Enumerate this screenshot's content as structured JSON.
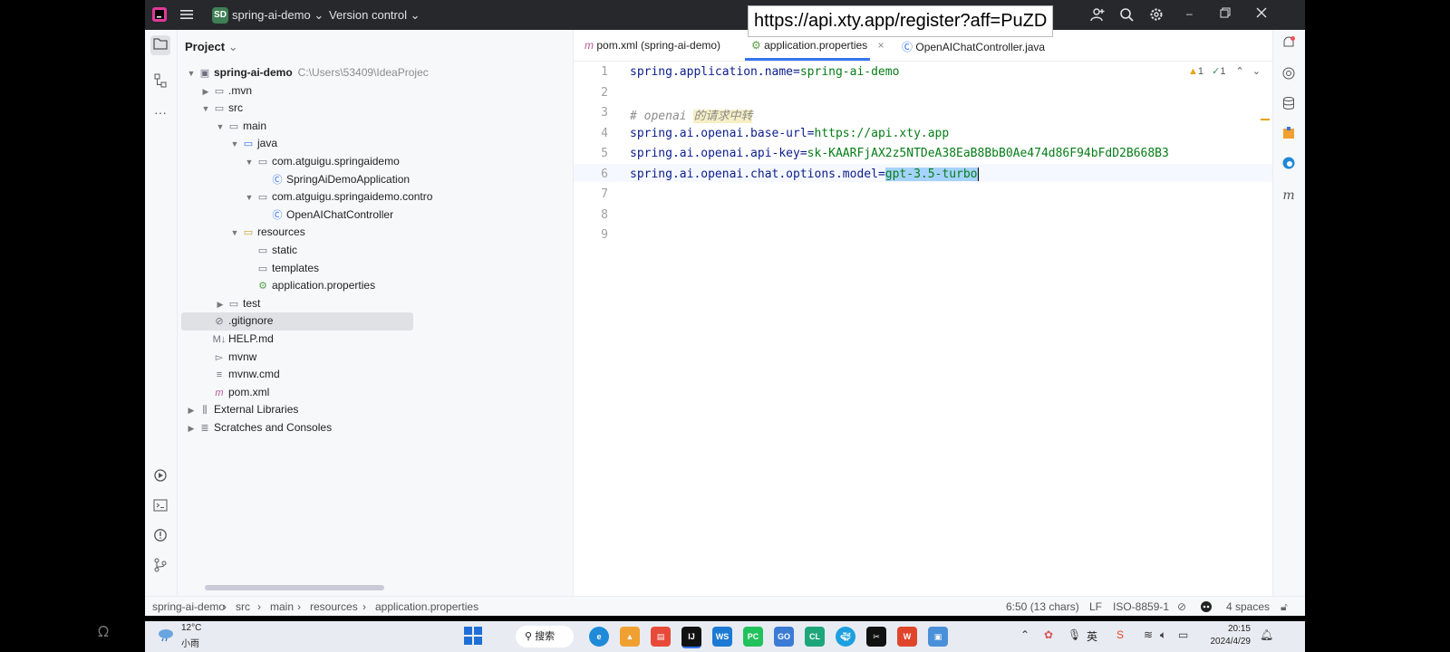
{
  "titlebar": {
    "project_badge": "SD",
    "project_name": "spring-ai-demo",
    "version_control": "Version control"
  },
  "overlay_url": "https://api.xty.app/register?aff=PuZD",
  "project_panel": {
    "title": "Project",
    "tree": [
      {
        "label": "spring-ai-demo",
        "path": "C:\\Users\\53409\\IdeaProjec",
        "depth": 0,
        "arrow": "down",
        "icon": "module-icon",
        "bold": true
      },
      {
        "label": ".mvn",
        "depth": 1,
        "arrow": "right",
        "icon": "folder-icon"
      },
      {
        "label": "src",
        "depth": 1,
        "arrow": "down",
        "icon": "folder-icon"
      },
      {
        "label": "main",
        "depth": 2,
        "arrow": "down",
        "icon": "folder-icon"
      },
      {
        "label": "java",
        "depth": 3,
        "arrow": "down",
        "icon": "source-folder-icon"
      },
      {
        "label": "com.atguigu.springaidemo",
        "depth": 4,
        "arrow": "down",
        "icon": "package-icon"
      },
      {
        "label": "SpringAiDemoApplication",
        "depth": 5,
        "arrow": "",
        "icon": "spring-class-icon"
      },
      {
        "label": "com.atguigu.springaidemo.contro",
        "depth": 4,
        "arrow": "down",
        "icon": "package-icon"
      },
      {
        "label": "OpenAIChatController",
        "depth": 5,
        "arrow": "",
        "icon": "class-icon"
      },
      {
        "label": "resources",
        "depth": 3,
        "arrow": "down",
        "icon": "resources-folder-icon"
      },
      {
        "label": "static",
        "depth": 4,
        "arrow": "",
        "icon": "folder-icon"
      },
      {
        "label": "templates",
        "depth": 4,
        "arrow": "",
        "icon": "folder-icon"
      },
      {
        "label": "application.properties",
        "depth": 4,
        "arrow": "",
        "icon": "spring-properties-icon"
      },
      {
        "label": "test",
        "depth": 2,
        "arrow": "right",
        "icon": "folder-icon"
      },
      {
        "label": ".gitignore",
        "depth": 1,
        "arrow": "",
        "icon": "ignore-file-icon"
      },
      {
        "label": "HELP.md",
        "depth": 1,
        "arrow": "",
        "icon": "markdown-icon"
      },
      {
        "label": "mvnw",
        "depth": 1,
        "arrow": "",
        "icon": "shell-file-icon"
      },
      {
        "label": "mvnw.cmd",
        "depth": 1,
        "arrow": "",
        "icon": "text-file-icon"
      },
      {
        "label": "pom.xml",
        "depth": 1,
        "arrow": "",
        "icon": "maven-icon"
      },
      {
        "label": "External Libraries",
        "depth": 0,
        "arrow": "right",
        "icon": "library-icon"
      },
      {
        "label": "Scratches and Consoles",
        "depth": 0,
        "arrow": "right",
        "icon": "scratches-icon"
      }
    ]
  },
  "tabs": [
    {
      "label": "pom.xml (spring-ai-demo)",
      "icon": "maven-icon"
    },
    {
      "label": "application.properties",
      "icon": "spring-properties-icon",
      "active": true
    },
    {
      "label": "OpenAIChatController.java",
      "icon": "class-icon"
    }
  ],
  "editor": {
    "line_numbers": [
      "1",
      "2",
      "3",
      "4",
      "5",
      "6",
      "7",
      "8",
      "9"
    ],
    "lines": [
      {
        "key": "spring.application.name",
        "eq": "=",
        "value": "spring-ai-demo"
      },
      {},
      {
        "comment": "# openai ",
        "comment_cjk": "的请求中转"
      },
      {
        "key": "spring.ai.openai.base-url",
        "eq": "=",
        "value": "https://api.xty.app"
      },
      {
        "key": "spring.ai.openai.api-key",
        "eq": "=",
        "value": "sk-KAARFjAX2z5NTDeA38EaB8BbB0Ae474d86F94bFdD2B668B3"
      },
      {
        "key": "spring.ai.openai.chat.options.model",
        "eq": "=",
        "value": "gpt-3.5-turbo",
        "selected": true
      },
      {},
      {},
      {}
    ],
    "inspections": {
      "warnings": "1",
      "ok": "1"
    }
  },
  "statusbar": {
    "breadcrumb": [
      "spring-ai-demo",
      "src",
      "main",
      "resources",
      "application.properties"
    ],
    "position": "6:50 (13 chars)",
    "line_sep": "LF",
    "encoding": "ISO-8859-1",
    "indent": "4 spaces"
  },
  "taskbar": {
    "weather_temp": "12°C",
    "weather_desc": "小雨",
    "search_label": "搜索",
    "time": "20:15",
    "date": "2024/4/29",
    "ime": "英"
  },
  "colors": {
    "accent": "#3574f0",
    "key": "#0b1d8c",
    "value": "#067d17",
    "selection": "#a6d2ff"
  }
}
